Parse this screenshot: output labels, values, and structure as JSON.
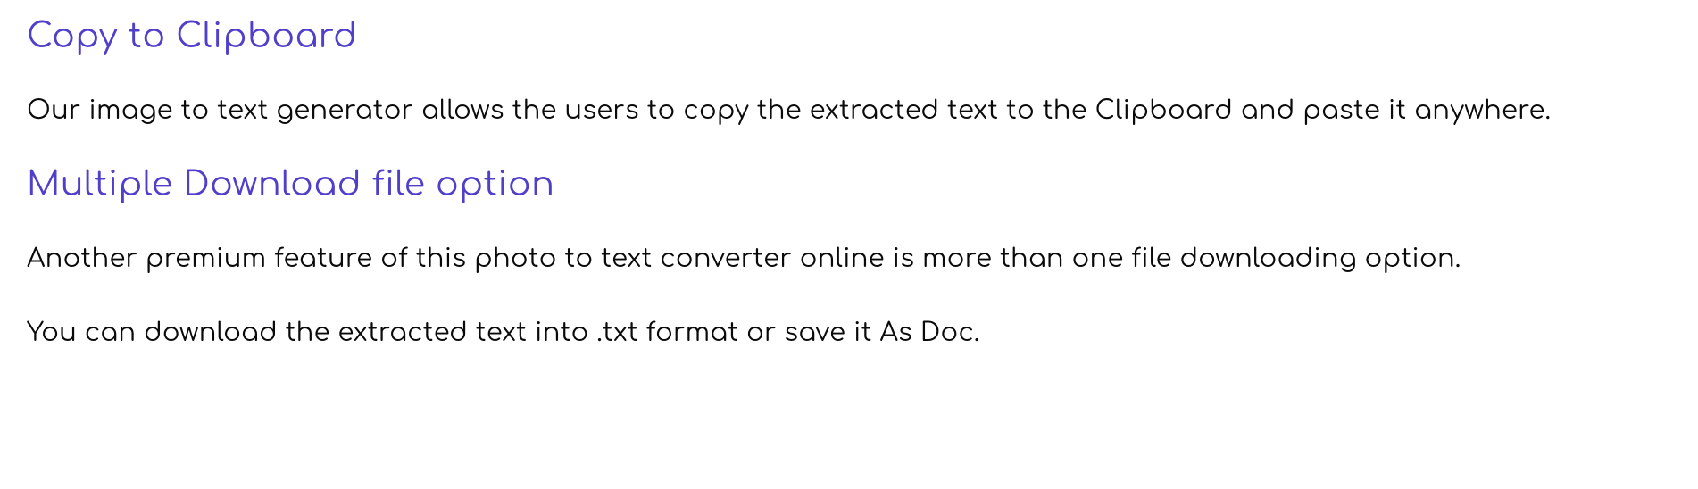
{
  "sections": [
    {
      "heading": "Copy to Clipboard",
      "paragraphs": [
        "Our image to text generator allows the users to copy the extracted text to the Clipboard and paste it anywhere."
      ]
    },
    {
      "heading": "Multiple Download file option",
      "paragraphs": [
        "Another premium feature of this photo to text converter online is more than one file downloading option.",
        "You can download the extracted text into .txt format or save it As Doc."
      ]
    }
  ]
}
